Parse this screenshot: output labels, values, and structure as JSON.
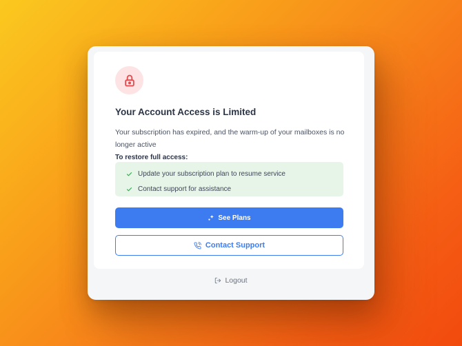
{
  "modal": {
    "title": "Your Account Access is Limited",
    "description": "Your subscription has expired, and the warm-up of your mailboxes is no longer active",
    "restore_heading": "To restore full access:",
    "checklist": [
      "Update your subscription plan to resume service",
      "Contact support for assistance"
    ],
    "primary_button": "See Plans",
    "secondary_button": "Contact Support",
    "logout": "Logout"
  },
  "icons": {
    "lock": "lock-icon",
    "check": "check-icon",
    "sparkle": "sparkle-icon",
    "phone": "phone-icon",
    "logout": "logout-icon"
  },
  "colors": {
    "accent": "#3d7cf0",
    "lock_bg": "#fde3e3",
    "lock_icon": "#e5484d",
    "checklist_bg": "#e7f5e9",
    "check_icon": "#3aa655"
  }
}
